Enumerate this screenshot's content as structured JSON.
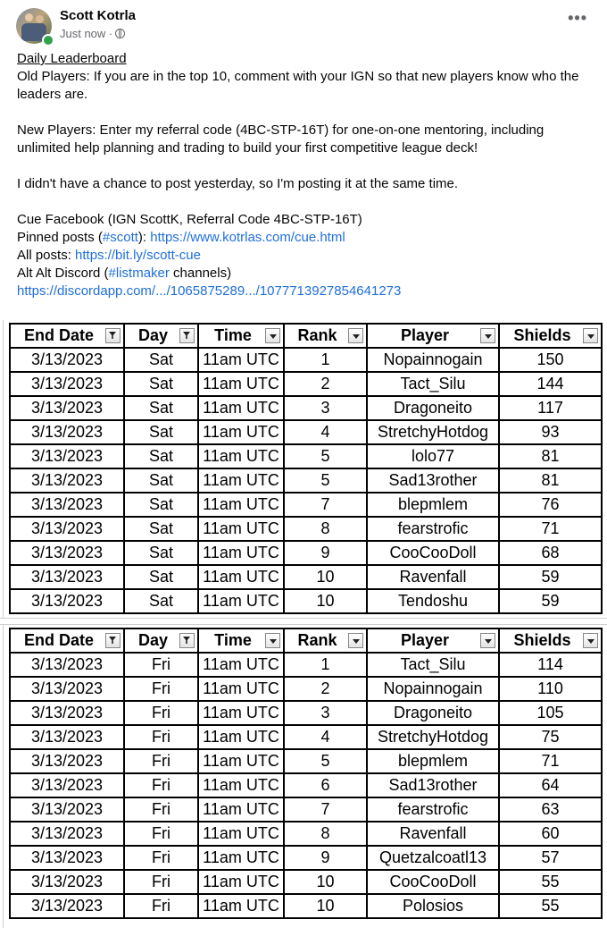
{
  "post": {
    "author": "Scott Kotrla",
    "timestamp": "Just now ·",
    "more_label": "•••"
  },
  "body": {
    "title": "Daily Leaderboard",
    "line1": "Old Players: If you are in the top 10, comment with your IGN so that new players know who the leaders are.",
    "line2": "New Players: Enter my referral code (4BC-STP-16T) for one-on-one mentoring, including unlimited help planning and trading to build your first competitive league deck!",
    "line3": "I didn't have a chance to post yesterday, so I'm posting it at the same time.",
    "line4": "Cue Facebook (IGN ScottK, Referral Code 4BC-STP-16T)",
    "pinned_prefix": "Pinned posts (",
    "pinned_tag": "#scott",
    "pinned_mid": "): ",
    "pinned_link": "https://www.kotrlas.com/cue.html",
    "all_prefix": "All posts: ",
    "all_link": "https://bit.ly/scott-cue",
    "discord_prefix": "Alt Alt Discord (",
    "discord_tag": "#listmaker",
    "discord_suffix": " channels)",
    "discord_link": "https://discordapp.com/.../1065875289.../1077713927854641273"
  },
  "table_headers": [
    "End Date",
    "Day",
    "Time",
    "Rank",
    "Player",
    "Shields"
  ],
  "table_sat": [
    [
      "3/13/2023",
      "Sat",
      "11am UTC",
      "1",
      "Nopainnogain",
      "150"
    ],
    [
      "3/13/2023",
      "Sat",
      "11am UTC",
      "2",
      "Tact_Silu",
      "144"
    ],
    [
      "3/13/2023",
      "Sat",
      "11am UTC",
      "3",
      "Dragoneito",
      "117"
    ],
    [
      "3/13/2023",
      "Sat",
      "11am UTC",
      "4",
      "StretchyHotdog",
      "93"
    ],
    [
      "3/13/2023",
      "Sat",
      "11am UTC",
      "5",
      "lolo77",
      "81"
    ],
    [
      "3/13/2023",
      "Sat",
      "11am UTC",
      "5",
      "Sad13rother",
      "81"
    ],
    [
      "3/13/2023",
      "Sat",
      "11am UTC",
      "7",
      "blepmlem",
      "76"
    ],
    [
      "3/13/2023",
      "Sat",
      "11am UTC",
      "8",
      "fearstrofic",
      "71"
    ],
    [
      "3/13/2023",
      "Sat",
      "11am UTC",
      "9",
      "CooCooDoll",
      "68"
    ],
    [
      "3/13/2023",
      "Sat",
      "11am UTC",
      "10",
      "Ravenfall",
      "59"
    ],
    [
      "3/13/2023",
      "Sat",
      "11am UTC",
      "10",
      "Tendoshu",
      "59"
    ]
  ],
  "table_fri": [
    [
      "3/13/2023",
      "Fri",
      "11am UTC",
      "1",
      "Tact_Silu",
      "114"
    ],
    [
      "3/13/2023",
      "Fri",
      "11am UTC",
      "2",
      "Nopainnogain",
      "110"
    ],
    [
      "3/13/2023",
      "Fri",
      "11am UTC",
      "3",
      "Dragoneito",
      "105"
    ],
    [
      "3/13/2023",
      "Fri",
      "11am UTC",
      "4",
      "StretchyHotdog",
      "75"
    ],
    [
      "3/13/2023",
      "Fri",
      "11am UTC",
      "5",
      "blepmlem",
      "71"
    ],
    [
      "3/13/2023",
      "Fri",
      "11am UTC",
      "6",
      "Sad13rother",
      "64"
    ],
    [
      "3/13/2023",
      "Fri",
      "11am UTC",
      "7",
      "fearstrofic",
      "63"
    ],
    [
      "3/13/2023",
      "Fri",
      "11am UTC",
      "8",
      "Ravenfall",
      "60"
    ],
    [
      "3/13/2023",
      "Fri",
      "11am UTC",
      "9",
      "Quetzalcoatl13",
      "57"
    ],
    [
      "3/13/2023",
      "Fri",
      "11am UTC",
      "10",
      "CooCooDoll",
      "55"
    ],
    [
      "3/13/2023",
      "Fri",
      "11am UTC",
      "10",
      "Polosios",
      "55"
    ]
  ],
  "colors": {
    "link": "#216fdb",
    "online": "#31a24c",
    "meta": "#65676b"
  },
  "icons": {
    "privacy": "globe-icon",
    "menu": "more-options-icon",
    "filter": "filter-dropdown-icon"
  }
}
